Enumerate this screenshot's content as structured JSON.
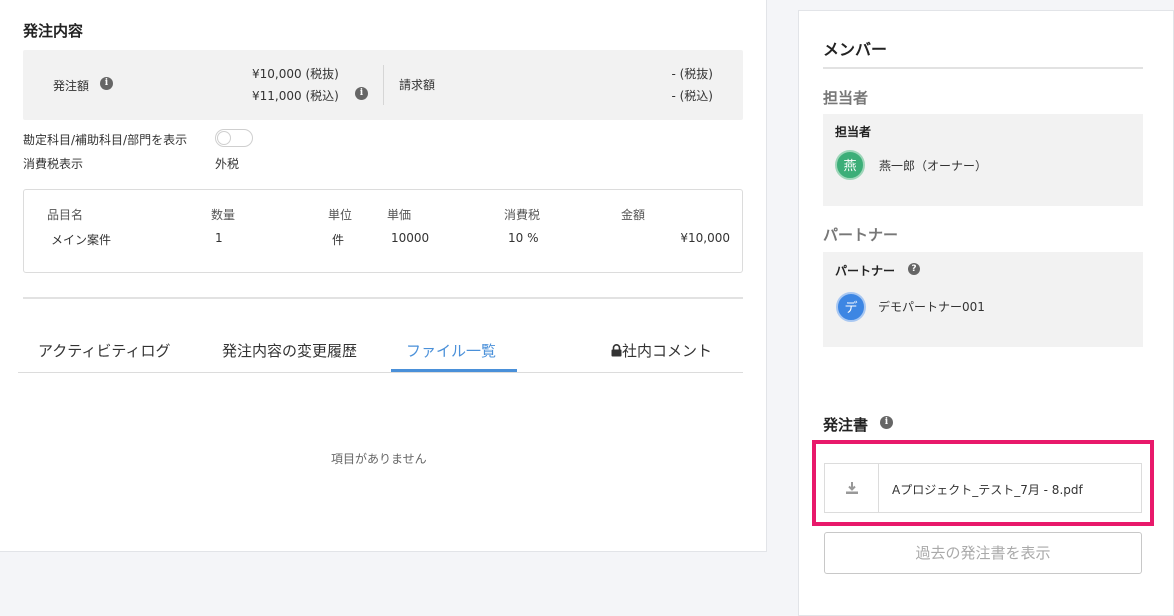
{
  "order": {
    "title": "発注内容",
    "amount_label": "発注額",
    "amount_excl": "¥10,000 (税抜)",
    "amount_incl": "¥11,000 (税込)",
    "invoice_label": "請求額",
    "invoice_excl": "- (税抜)",
    "invoice_incl": "- (税込)",
    "show_accounts_label": "勘定科目/補助科目/部門を表示",
    "tax_label": "消費税表示",
    "tax_value": "外税"
  },
  "items_table": {
    "headers": [
      "品目名",
      "数量",
      "単位",
      "単価",
      "消費税",
      "金額"
    ],
    "rows": [
      {
        "name": "メイン案件",
        "qty": "1",
        "unit": "件",
        "price": "10000",
        "tax": "10 %",
        "amount": "¥10,000"
      }
    ]
  },
  "tabs": [
    {
      "label": "アクティビティログ"
    },
    {
      "label": "発注内容の変更履歴"
    },
    {
      "label": "ファイル一覧",
      "active": true
    },
    {
      "label": "社内コメント"
    }
  ],
  "empty_message": "項目がありません",
  "members": {
    "title": "メンバー",
    "manager_section": "担当者",
    "manager_label": "担当者",
    "manager_avatar": "燕",
    "manager_name": "燕一郎（オーナー）",
    "partner_section": "パートナー",
    "partner_label": "パートナー",
    "partner_avatar": "デ",
    "partner_name": "デモパートナー001"
  },
  "purchase_order": {
    "title": "発注書",
    "file_name": "Aプロジェクト_テスト_7月 - 8.pdf",
    "past_button": "過去の発注書を表示"
  },
  "colors": {
    "accent": "#4a90d9",
    "highlight": "#e8196b",
    "manager_avatar": "#3cae78",
    "partner_avatar": "#3d86e3"
  }
}
